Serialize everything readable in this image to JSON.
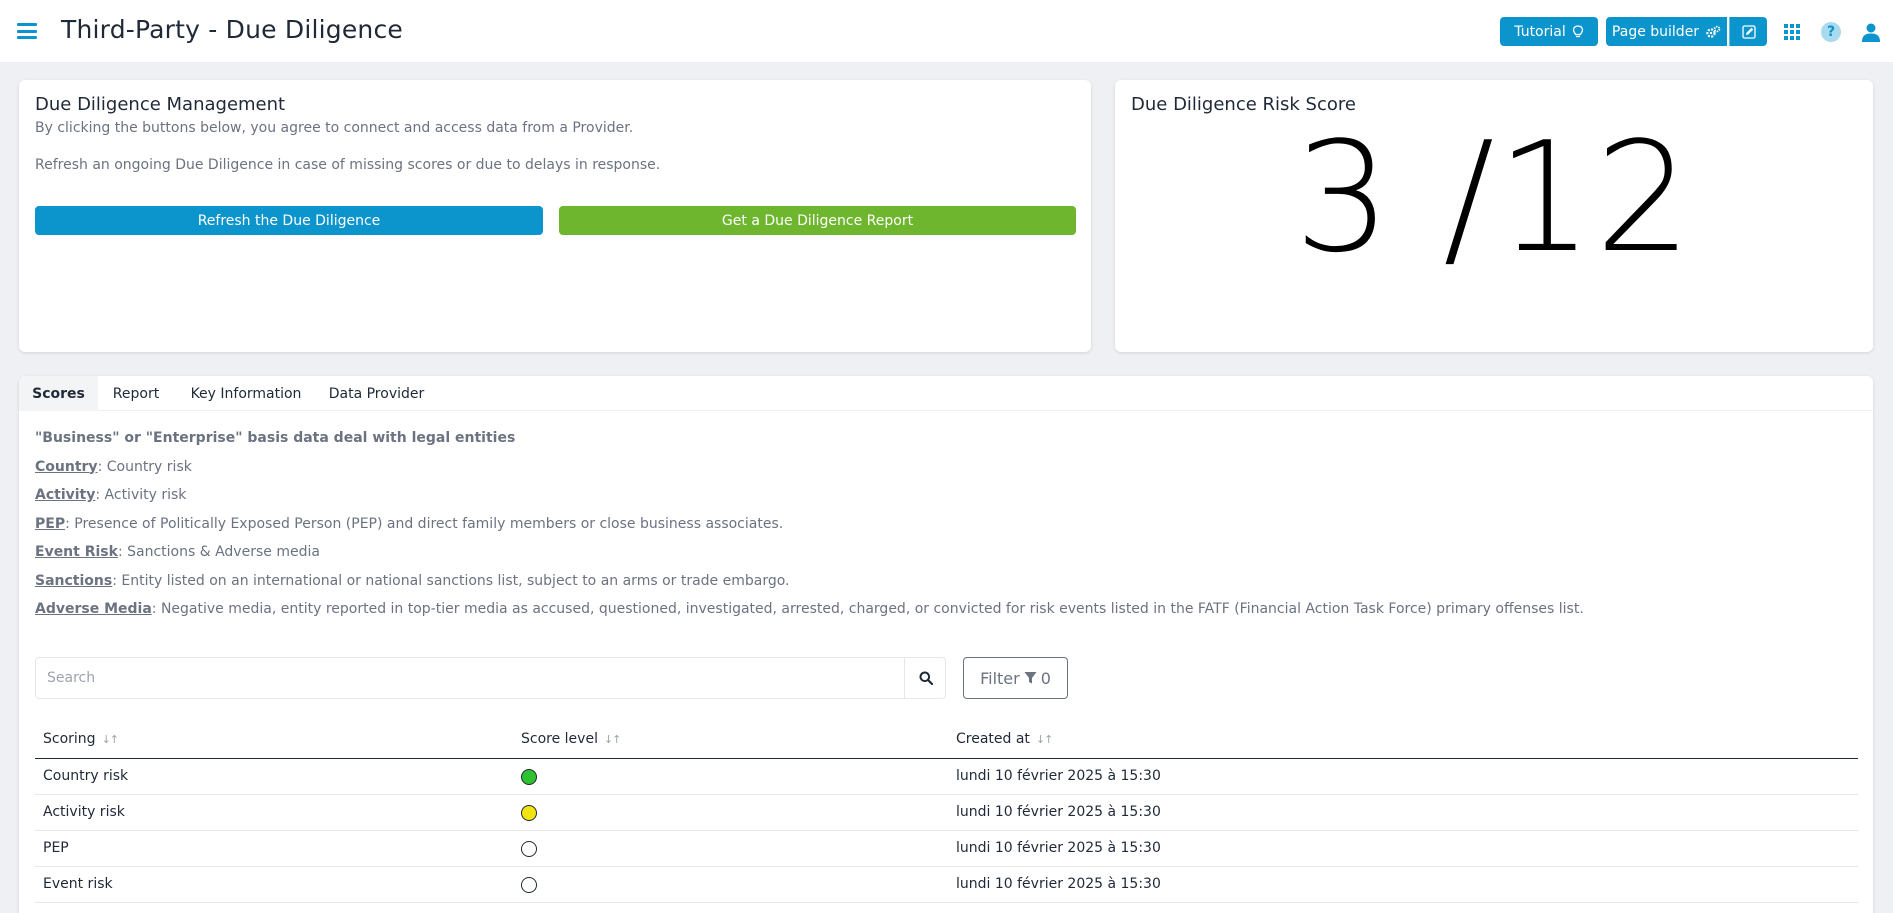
{
  "header": {
    "title": "Third-Party - Due Diligence",
    "tutorial_label": "Tutorial",
    "page_builder_label": "Page builder",
    "help_glyph": "?"
  },
  "management": {
    "title": "Due Diligence Management",
    "desc1": "By clicking the buttons below, you agree to connect and access data from a Provider.",
    "desc2": "Refresh an ongoing Due Diligence in case of missing scores or due to delays in response.",
    "refresh_label": "Refresh the Due Diligence",
    "report_label": "Get a Due Diligence Report"
  },
  "risk_score": {
    "title": "Due Diligence Risk Score",
    "value": "3 /12"
  },
  "tabs": [
    {
      "label": "Scores",
      "active": true
    },
    {
      "label": "Report",
      "active": false
    },
    {
      "label": "Key Information",
      "active": false
    },
    {
      "label": "Data Provider",
      "active": false
    }
  ],
  "definitions": {
    "intro": "\"Business\" or \"Enterprise\" basis data deal with legal entities",
    "items": [
      {
        "term": "Country",
        "text": ": Country risk"
      },
      {
        "term": "Activity",
        "text": ": Activity risk"
      },
      {
        "term": "PEP",
        "text": ": Presence of Politically Exposed Person (PEP) and direct family members or close business associates."
      },
      {
        "term": "Event Risk",
        "text": ": Sanctions & Adverse media"
      },
      {
        "term": "Sanctions",
        "text": ": Entity listed on an international or national sanctions list, subject to an arms or trade embargo."
      },
      {
        "term": "Adverse Media",
        "text": ": Negative media, entity reported in top-tier media as accused, questioned, investigated, arrested, charged, or convicted for risk events listed in the FATF (Financial Action Task Force) primary offenses list."
      }
    ]
  },
  "search": {
    "placeholder": "Search"
  },
  "filter": {
    "label": "Filter",
    "count": "0"
  },
  "table": {
    "headers": [
      "Scoring",
      "Score level",
      "Created at"
    ],
    "rows": [
      {
        "scoring": "Country risk",
        "level_color": "#2fc12f",
        "created": "lundi 10 février 2025 à 15:30"
      },
      {
        "scoring": "Activity risk",
        "level_color": "#f2e312",
        "created": "lundi 10 février 2025 à 15:30"
      },
      {
        "scoring": "PEP",
        "level_color": "#ffffff",
        "created": "lundi 10 février 2025 à 15:30"
      },
      {
        "scoring": "Event risk",
        "level_color": "#ffffff",
        "created": "lundi 10 février 2025 à 15:30"
      }
    ]
  },
  "colors": {
    "accent": "#0c94cc",
    "green_button": "#6db62d"
  }
}
